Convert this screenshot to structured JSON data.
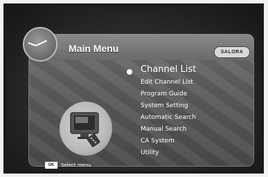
{
  "header": {
    "title": "Main Menu",
    "brand": "SALORA"
  },
  "menu": {
    "selected_index": 0,
    "items": [
      {
        "label": "Channel List"
      },
      {
        "label": "Edit Channel List"
      },
      {
        "label": "Program Guide"
      },
      {
        "label": "System Setting"
      },
      {
        "label": "Automatic Search"
      },
      {
        "label": "Manual Search"
      },
      {
        "label": "CA System"
      },
      {
        "label": "Utility"
      }
    ]
  },
  "footer": {
    "key_label": "OK",
    "hint": "Select menu"
  },
  "icons": {
    "clock": "clock-icon",
    "tv_illustration": "tv-remote-icon",
    "selection_bullet": "bullet-icon"
  },
  "colors": {
    "panel": "#5e5e5e",
    "text": "#ffffff",
    "frame": "#1a1a1a"
  }
}
